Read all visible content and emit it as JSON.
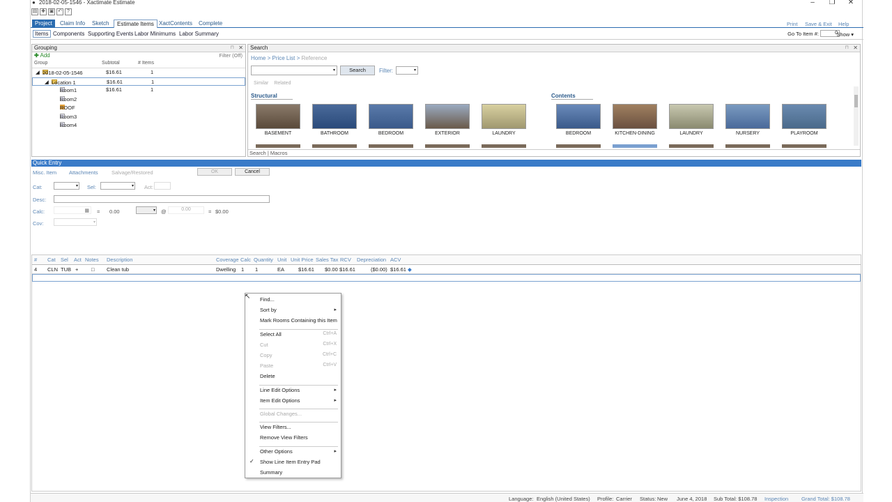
{
  "window": {
    "title": "2018-02-05-1546 - Xactimate Estimate"
  },
  "menu": {
    "tabs": [
      "Project",
      "Claim Info",
      "Sketch",
      "Estimate Items",
      "XactContents",
      "Complete"
    ],
    "right": [
      "Print",
      "Save & Exit",
      "Help"
    ]
  },
  "subtabs": [
    "Items",
    "Components",
    "Supporting Events",
    "Labor Minimums",
    "Labor Summary"
  ],
  "goto": {
    "label": "Go To Item #:",
    "value": "0",
    "show": "Show ▾"
  },
  "grouping": {
    "title": "Grouping",
    "add": "Add",
    "filter": "Filter (Off)",
    "cols": [
      "Group",
      "Subtotal",
      "# Items"
    ],
    "rows": [
      {
        "name": "2018-02-05-1546",
        "subtotal": "$16.61",
        "items": "1"
      },
      {
        "name": "Location 1",
        "subtotal": "$16.61",
        "items": "1"
      },
      {
        "name": "Room1",
        "subtotal": "$16.61",
        "items": "1"
      },
      {
        "name": "Room2",
        "subtotal": "",
        "items": ""
      },
      {
        "name": "ROOF",
        "subtotal": "",
        "items": ""
      },
      {
        "name": "Room3",
        "subtotal": "",
        "items": ""
      },
      {
        "name": "Room4",
        "subtotal": "",
        "items": ""
      }
    ]
  },
  "search": {
    "title": "Search",
    "crumb": [
      "Home",
      ">",
      "Price List",
      ">",
      "Reference"
    ],
    "button": "Search",
    "filter": "Filter:",
    "similar": "Similar",
    "related": "Related",
    "structural": {
      "title": "Structural",
      "items": [
        "BASEMENT",
        "BATHROOM",
        "BEDROOM",
        "EXTERIOR",
        "LAUNDRY"
      ]
    },
    "contents": {
      "title": "Contents",
      "items": [
        "BEDROOM",
        "KITCHEN-DINING",
        "LAUNDRY",
        "NURSERY",
        "PLAYROOM"
      ]
    },
    "foot": [
      "Search",
      "Macros"
    ]
  },
  "quick": {
    "title": "Quick Entry",
    "tabs": [
      "Misc. Item",
      "Attachments",
      "Salvage/Restored"
    ],
    "ok": "OK",
    "cancel": "Cancel",
    "cat": "Cat:",
    "sel": "Sel:",
    "act": "Act:",
    "desc": "Desc:",
    "calc": "Calc:",
    "cov": "Cov:",
    "eq1": "=",
    "v1": "0.00",
    "at": "@",
    "v2": "0.00",
    "eq2": "=",
    "total": "$0.00"
  },
  "table": {
    "headers": [
      "#",
      "Cat",
      "Sel",
      "Act",
      "Notes",
      "Description",
      "Coverage",
      "Calc",
      "Quantity",
      "Unit",
      "Unit Price",
      "Sales Tax",
      "RCV",
      "Depreciation",
      "ACV"
    ],
    "row": [
      "4",
      "CLN",
      "TUB",
      "+",
      "□",
      "Clean tub",
      "Dwelling",
      "1",
      "1",
      "EA",
      "$16.61",
      "$0.00",
      "$16.61",
      "($0.00)",
      "$16.61"
    ]
  },
  "context_menu": [
    {
      "label": "Find...",
      "sc": ""
    },
    {
      "label": "Sort by",
      "arrow": true
    },
    {
      "label": "Mark Rooms Containing this Item"
    },
    {
      "sep": true
    },
    {
      "label": "Select All",
      "sc": "Ctrl+A"
    },
    {
      "label": "Cut",
      "sc": "Ctrl+X",
      "dis": true
    },
    {
      "label": "Copy",
      "sc": "Ctrl+C",
      "dis": true
    },
    {
      "label": "Paste",
      "sc": "Ctrl+V",
      "dis": true
    },
    {
      "label": "Delete"
    },
    {
      "sep": true
    },
    {
      "label": "Line Edit Options",
      "arrow": true
    },
    {
      "label": "Item Edit Options",
      "arrow": true
    },
    {
      "sep": true
    },
    {
      "label": "Global Changes...",
      "dis": true
    },
    {
      "sep": true
    },
    {
      "label": "View Filters..."
    },
    {
      "label": "Remove View Filters"
    },
    {
      "sep": true
    },
    {
      "label": "Other Options",
      "arrow": true
    },
    {
      "label": "Show Line Item Entry Pad",
      "check": true
    },
    {
      "label": "Summary"
    }
  ],
  "status": {
    "language_label": "Language:",
    "language": "English (United States)",
    "profile_label": "Profile:",
    "profile": "Carrier",
    "status_label": "Status:",
    "status": "New",
    "date": "June 4, 2018",
    "subtotal": "Sub Total: $108.78",
    "inspection": "Inspection",
    "grand": "Grand Total: $108.78"
  }
}
